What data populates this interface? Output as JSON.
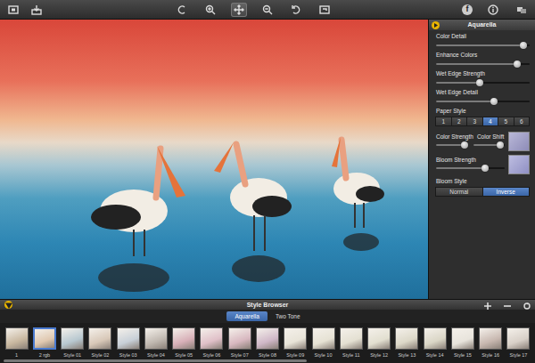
{
  "toolbar": {
    "left": [
      {
        "kind": "fit"
      },
      {
        "kind": "export"
      }
    ],
    "tools": [
      {
        "kind": "rotate-left",
        "selected": false
      },
      {
        "kind": "zoom-in",
        "selected": false
      },
      {
        "kind": "move",
        "selected": true
      },
      {
        "kind": "zoom-out",
        "selected": false
      },
      {
        "kind": "rotate-right",
        "selected": false
      },
      {
        "kind": "crop",
        "selected": false
      }
    ],
    "facebook": "f"
  },
  "panel": {
    "title": "Aquarella",
    "sliders": [
      {
        "label": "Color Detail",
        "level": 0.93
      },
      {
        "label": "Enhance Colors",
        "level": 0.87
      },
      {
        "label": "Wet Edge Strength",
        "level": 0.47
      },
      {
        "label": "Wet Edge Detail",
        "level": 0.62
      }
    ],
    "paper_style": {
      "label": "Paper Style",
      "options": [
        {
          "label": "1",
          "selected": false
        },
        {
          "label": "2",
          "selected": false
        },
        {
          "label": "3",
          "selected": false
        },
        {
          "label": "4",
          "selected": true
        },
        {
          "label": "5",
          "selected": false
        },
        {
          "label": "6",
          "selected": false
        }
      ]
    },
    "color": {
      "strength": {
        "label": "Color Strength",
        "level": 0.9
      },
      "shift": {
        "label": "Color Shift",
        "level": 0.85
      },
      "swatch": "#b9b8d8"
    },
    "bloom": {
      "label": "Bloom Strength",
      "level": 0.72,
      "swatch": "#bdbde0"
    },
    "bloom_style": {
      "label": "Bloom Style",
      "options": [
        {
          "label": "Normal",
          "selected": false
        },
        {
          "label": "Inverse",
          "selected": true
        }
      ]
    }
  },
  "style_browser": {
    "title": "Style Browser",
    "tabs": [
      {
        "label": "Aquarella",
        "selected": true
      },
      {
        "label": "Two Tone",
        "selected": false
      }
    ],
    "thumbnails": [
      {
        "label": "1",
        "selected": false
      },
      {
        "label": "2 rgb",
        "selected": true
      },
      {
        "label": "Style 01",
        "selected": false
      },
      {
        "label": "Style 02",
        "selected": false
      },
      {
        "label": "Style 03",
        "selected": false
      },
      {
        "label": "Style 04",
        "selected": false
      },
      {
        "label": "Style 05",
        "selected": false
      },
      {
        "label": "Style 06",
        "selected": false
      },
      {
        "label": "Style 07",
        "selected": false
      },
      {
        "label": "Style 08",
        "selected": false
      },
      {
        "label": "Style 09",
        "selected": false
      },
      {
        "label": "Style 10",
        "selected": false
      },
      {
        "label": "Style 11",
        "selected": false
      },
      {
        "label": "Style 12",
        "selected": false
      },
      {
        "label": "Style 13",
        "selected": false
      },
      {
        "label": "Style 14",
        "selected": false
      },
      {
        "label": "Style 15",
        "selected": false
      },
      {
        "label": "Style 16",
        "selected": false
      },
      {
        "label": "Style 17",
        "selected": false
      }
    ]
  }
}
